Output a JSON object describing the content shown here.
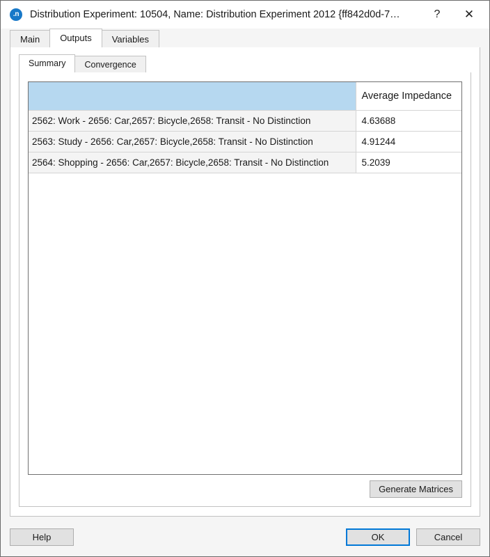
{
  "window": {
    "title": "Distribution Experiment: 10504, Name: Distribution Experiment 2012  {ff842d0d-7…",
    "icon_label": ".n",
    "help_glyph": "?",
    "close_glyph": "✕",
    "accent_color": "#0078d7",
    "header_color": "#b6d8f0",
    "icon_color": "#1878c8"
  },
  "outer_tabs": [
    {
      "label": "Main",
      "active": false
    },
    {
      "label": "Outputs",
      "active": true
    },
    {
      "label": "Variables",
      "active": false
    }
  ],
  "inner_tabs": [
    {
      "label": "Summary",
      "active": true
    },
    {
      "label": "Convergence",
      "active": false
    }
  ],
  "table": {
    "columns": [
      "",
      "Average Impedance"
    ],
    "rows": [
      {
        "name": "2562: Work - 2656: Car,2657: Bicycle,2658: Transit - No Distinction",
        "average_impedance": "4.63688"
      },
      {
        "name": "2563: Study - 2656: Car,2657: Bicycle,2658: Transit - No Distinction",
        "average_impedance": "4.91244"
      },
      {
        "name": "2564: Shopping - 2656: Car,2657: Bicycle,2658: Transit - No Distinction",
        "average_impedance": "5.2039"
      }
    ]
  },
  "buttons": {
    "generate_matrices": "Generate Matrices",
    "help": "Help",
    "ok": "OK",
    "cancel": "Cancel"
  }
}
